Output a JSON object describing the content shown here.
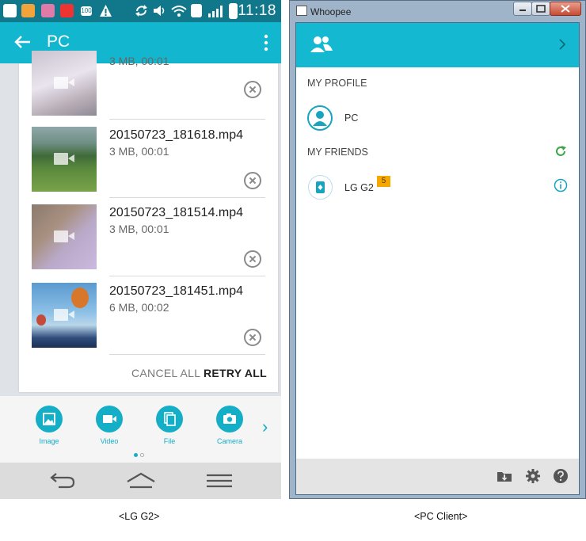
{
  "phone": {
    "status_bar": {
      "time": "11:18",
      "battery": "100"
    },
    "app_bar": {
      "title": "PC"
    },
    "files": [
      {
        "name": "",
        "meta": "3 MB, 00:01"
      },
      {
        "name": "20150723_181618.mp4",
        "meta": "3 MB, 00:01"
      },
      {
        "name": "20150723_181514.mp4",
        "meta": "3 MB, 00:01"
      },
      {
        "name": "20150723_181451.mp4",
        "meta": "6 MB, 00:02"
      }
    ],
    "actions": {
      "cancel_all": "CANCEL ALL",
      "retry_all": "RETRY ALL"
    },
    "share": [
      {
        "label": "Image",
        "icon": "image-icon"
      },
      {
        "label": "Video",
        "icon": "video-icon"
      },
      {
        "label": "File",
        "icon": "file-icon"
      },
      {
        "label": "Camera",
        "icon": "camera-icon"
      }
    ],
    "nav": [
      "back-icon",
      "home-icon",
      "menu-icon"
    ]
  },
  "pc": {
    "window_title": "Whoopee",
    "my_profile_heading": "MY PROFILE",
    "profile_name": "PC",
    "my_friends_heading": "MY FRIENDS",
    "friend_name": "LG G2",
    "friend_badge": "5"
  },
  "captions": {
    "left": "<LG G2>",
    "right": "<PC Client>"
  },
  "colors": {
    "accent": "#14b9d1",
    "status_bar": "#11778a",
    "badge": "#f5a800",
    "green_refresh": "#3aa64a"
  }
}
